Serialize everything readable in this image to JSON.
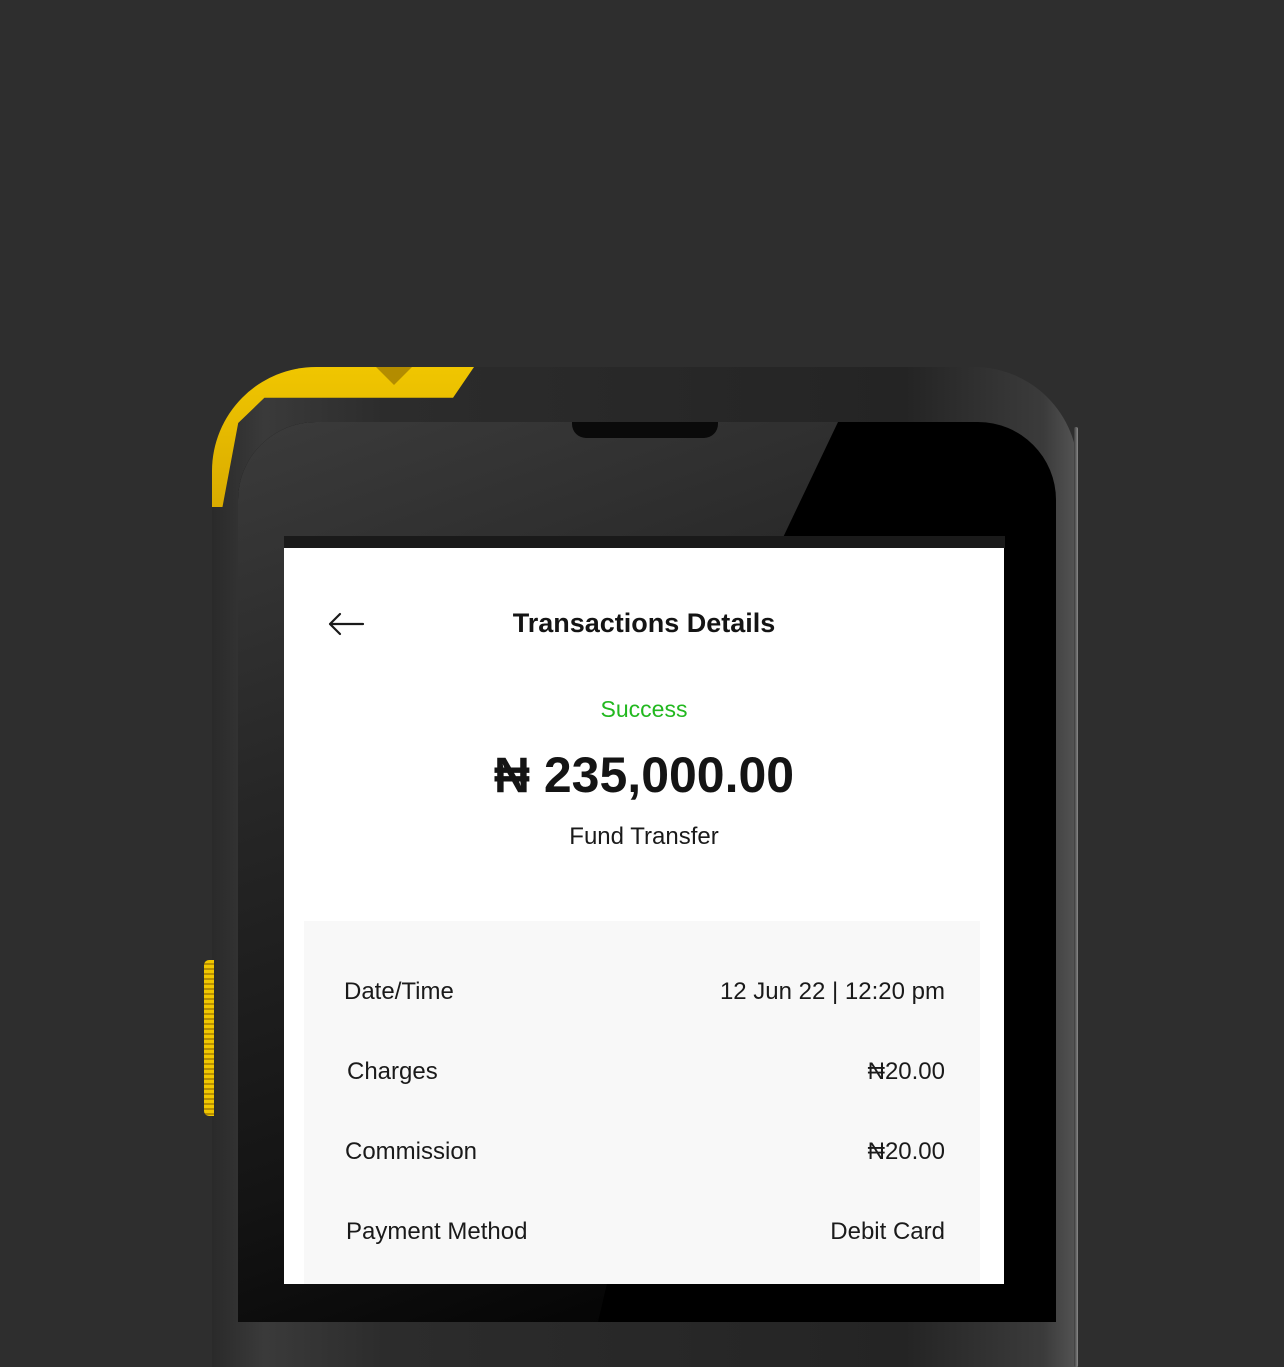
{
  "header": {
    "title": "Transactions Details",
    "back_icon": "arrow-left-icon"
  },
  "summary": {
    "status": "Success",
    "status_color": "#22b81f",
    "amount": "₦ 235,000.00",
    "type": "Fund Transfer"
  },
  "details": {
    "rows": [
      {
        "label": "Date/Time",
        "value": "12 Jun 22 | 12:20 pm"
      },
      {
        "label": "Charges",
        "value": "₦20.00"
      },
      {
        "label": "Commission",
        "value": "₦20.00"
      },
      {
        "label": "Payment Method",
        "value": "Debit Card"
      }
    ]
  },
  "device": {
    "accent_color": "#f0c600"
  }
}
